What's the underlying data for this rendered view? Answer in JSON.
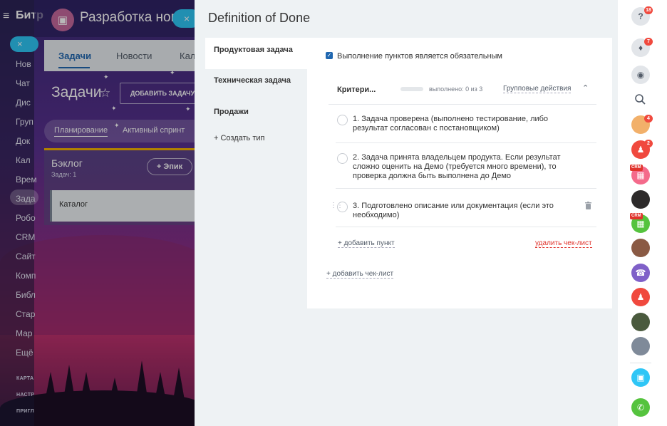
{
  "left_nav": {
    "title": "Битр",
    "items": [
      "Нов",
      "Чат",
      "Дис",
      "Груп",
      "Док",
      "Кал",
      "Врем",
      "Зада",
      "Робо",
      "CRM",
      "Сайт",
      "Комп",
      "Библ",
      "Стар",
      "Мар",
      "Ещё"
    ],
    "small_items": [
      "КАРТА",
      "НАСТР",
      "ПРИГЛ"
    ]
  },
  "project": {
    "title": "Разработка нов",
    "tabs": [
      "Задачи",
      "Новости",
      "Кале"
    ],
    "tasks_title": "Задачи",
    "add_task_label": "ДОБАВИТЬ ЗАДАЧУ",
    "sprint_tabs": [
      "Планирование",
      "Активный спринт"
    ],
    "backlog": {
      "title": "Бэклог",
      "count": "Задач: 1",
      "epic_button": "+ Эпик",
      "card": "Каталог"
    }
  },
  "slider": {
    "title": "Definition of Done",
    "types": [
      "Продуктовая задача",
      "Техническая задача",
      "Продажи"
    ],
    "add_type": "+ Создать тип",
    "required_label": "Выполнение пунктов является обязательным",
    "checklist": {
      "title": "Критери...",
      "done_text": "выполнено: 0 из 3",
      "progress": 0,
      "group_actions": "Групповые действия",
      "items": [
        {
          "num": "1.",
          "text": "Задача проверена (выполнено тестирование, либо результат согласован с постановщиком)"
        },
        {
          "num": "2.",
          "text": "Задача принята владельцем продукта. Если результат сложно оценить на Демо (требуется много времени), то проверка должна быть выполнена до Демо"
        },
        {
          "num": "3.",
          "text": "Подготовлено описание или документация (если это необходимо)"
        }
      ],
      "add_item": "+ добавить пункт",
      "delete_list": "удалить чек-лист"
    },
    "add_checklist": "+ добавить чек-лист"
  },
  "right_bar": {
    "help_badge": "18",
    "notif_badge": "7",
    "avatar1_badge": "4",
    "group_badge": "2",
    "crm_label": "CRM"
  }
}
